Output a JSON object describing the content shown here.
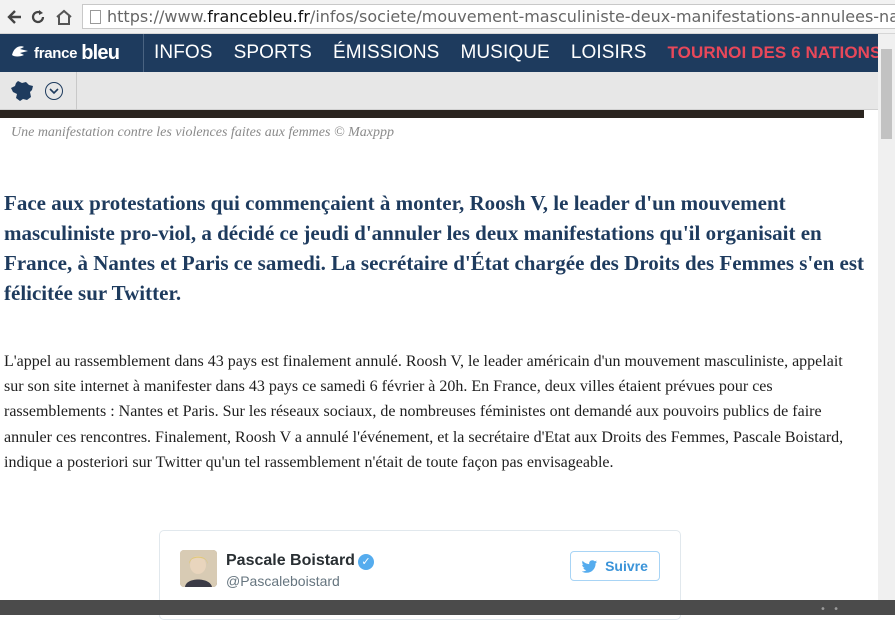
{
  "browser": {
    "url_scheme": "https://www.",
    "url_domain": "francebleu.fr",
    "url_path": "/infos/societe/mouvement-masculiniste-deux-manifestations-annulees-nantes-et-paris"
  },
  "site": {
    "logo_part1": "france",
    "logo_part2": "bleu",
    "menu": [
      "INFOS",
      "SPORTS",
      "ÉMISSIONS",
      "MUSIQUE",
      "LOISIRS"
    ],
    "promo": "TOURNOI DES 6 NATIONS"
  },
  "article": {
    "caption": "Une manifestation contre les violences faites aux femmes © Maxppp",
    "lead": "Face aux protestations qui commençaient à monter, Roosh V, le leader d'un mouvement masculiniste pro-viol, a décidé ce jeudi d'annuler les deux manifestations qu'il organisait en France, à Nantes et Paris ce samedi. La secrétaire d'État chargée des Droits des Femmes s'en est félicitée sur Twitter.",
    "body": "L'appel au rassemblement dans 43 pays est finalement annulé. Roosh V, le leader américain d'un mouvement masculiniste, appelait sur son site internet à manifester dans 43 pays ce samedi 6 février à 20h. En France, deux villes étaient prévues pour ces rassemblements : Nantes et Paris. Sur les réseaux sociaux, de nombreuses féministes ont demandé aux pouvoirs publics de faire annuler ces rencontres. Finalement, Roosh V a annulé l'événement, et la secrétaire d'Etat aux Droits des Femmes, Pascale Boistard, indique a posteriori sur Twitter qu'un tel rassemblement n'était de toute façon pas envisageable."
  },
  "tweet": {
    "name": "Pascale Boistard",
    "handle": "@Pascaleboistard",
    "follow_label": "Suivre"
  },
  "colors": {
    "nav_bg": "#1e3b5e",
    "promo": "#e8485a",
    "lead_text": "#1e3b5e",
    "twitter_blue": "#55acee"
  },
  "icons": [
    "back-icon",
    "reload-icon",
    "home-icon",
    "page-icon",
    "france-bleu-logo-icon",
    "france-map-icon",
    "chevron-down-icon",
    "verified-icon",
    "twitter-bird-icon"
  ]
}
